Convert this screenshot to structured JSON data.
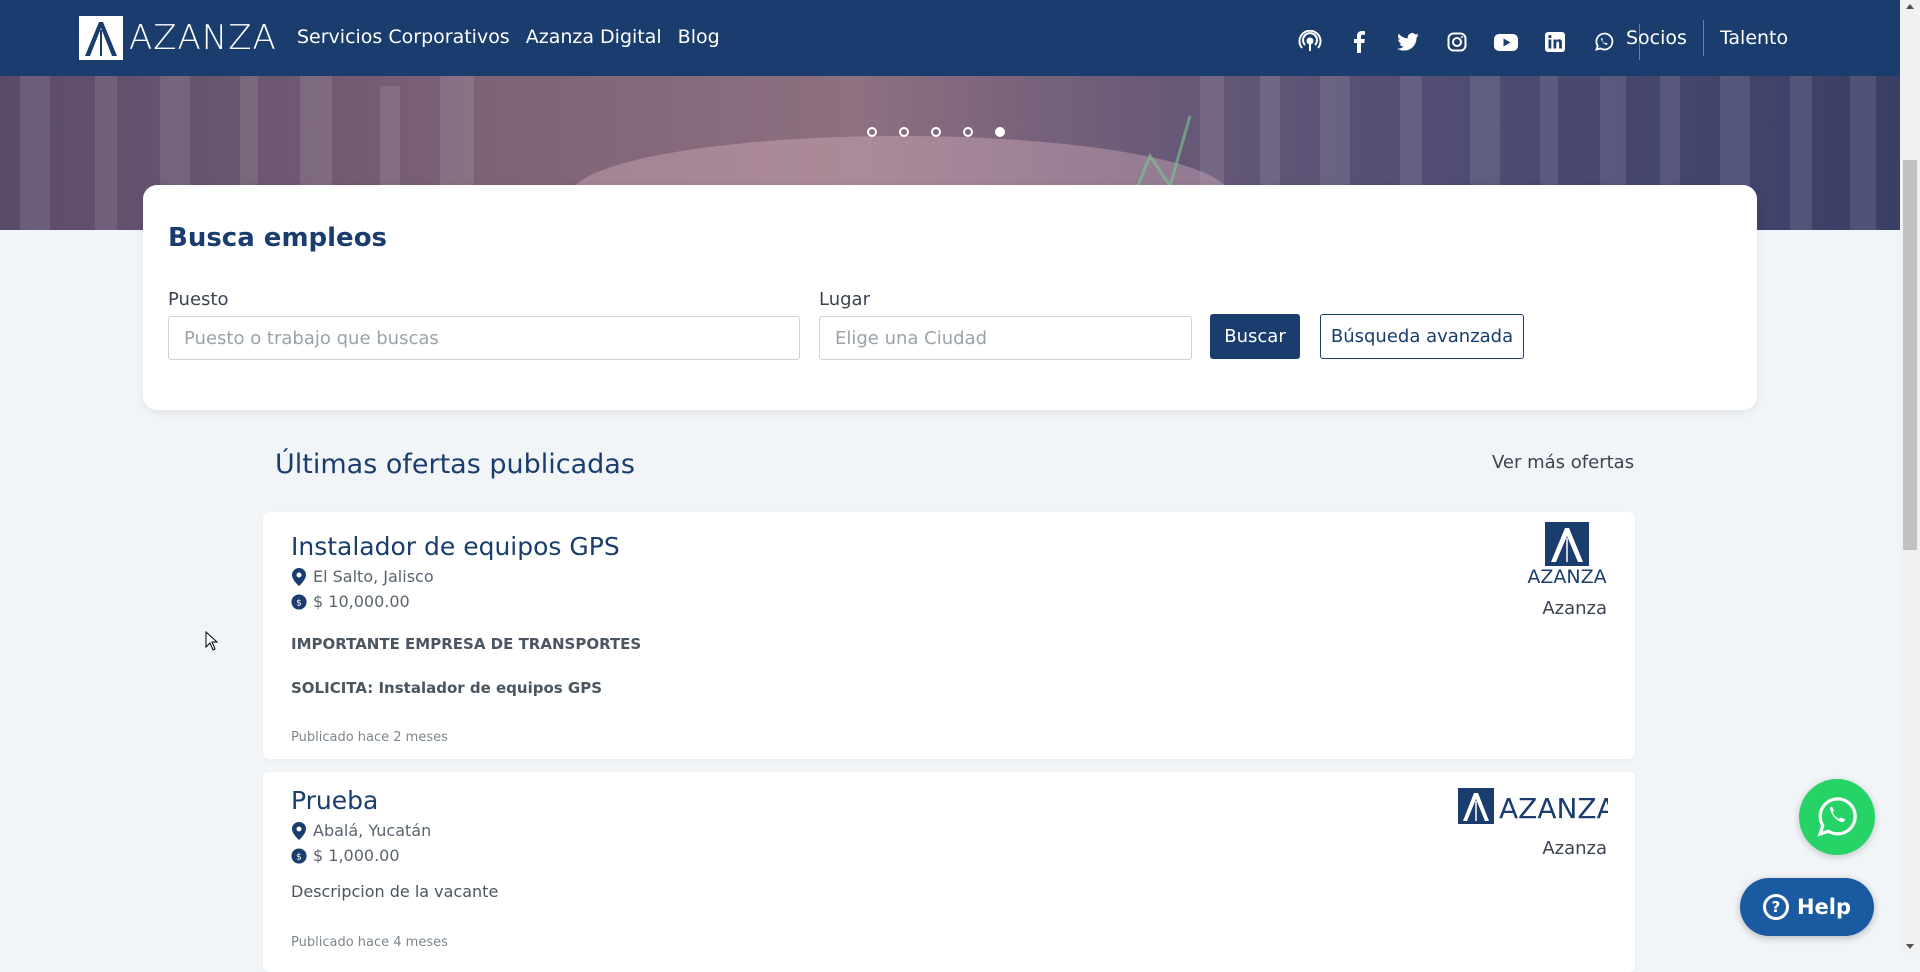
{
  "nav": {
    "brand": "AZANZA",
    "links": [
      "Servicios Corporativos",
      "Azanza Digital",
      "Blog"
    ],
    "social_icons": [
      "podcast-icon",
      "facebook-icon",
      "twitter-icon",
      "instagram-icon",
      "youtube-icon",
      "linkedin-icon",
      "whatsapp-icon"
    ],
    "right_links": [
      "Socios",
      "Talento"
    ]
  },
  "hero": {
    "slide_count": 5,
    "active_slide": 5
  },
  "search": {
    "title": "Busca empleos",
    "puesto_label": "Puesto",
    "puesto_placeholder": "Puesto o trabajo que buscas",
    "lugar_label": "Lugar",
    "lugar_placeholder": "Elige una Ciudad",
    "search_button": "Buscar",
    "advanced_button": "Búsqueda avanzada"
  },
  "offers": {
    "title": "Últimas ofertas publicadas",
    "more_link": "Ver más ofertas",
    "items": [
      {
        "title": "Instalador de equipos GPS",
        "location": "El Salto, Jalisco",
        "salary": "$ 10,000.00",
        "desc_lines": [
          "IMPORTANTE EMPRESA DE TRANSPORTES",
          "SOLICITA: Instalador de equipos GPS"
        ],
        "published": "Publicado hace 2 meses",
        "company": "Azanza",
        "logo_text": "AZANZA"
      },
      {
        "title": "Prueba",
        "location": "Abalá, Yucatán",
        "salary": "$ 1,000.00",
        "desc_lines": [
          "Descripcion de la vacante"
        ],
        "published": "Publicado hace 4 meses",
        "company": "Azanza",
        "logo_text": "AZANZA"
      }
    ]
  },
  "floating": {
    "whatsapp_icon": "whatsapp-icon",
    "help_label": "Help"
  },
  "colors": {
    "primary": "#1a3d6d",
    "whatsapp": "#25d366",
    "help": "#1a5aa0",
    "background": "#f2f5f8"
  }
}
